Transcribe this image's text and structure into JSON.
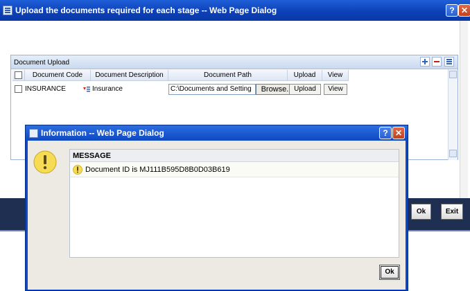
{
  "window": {
    "title": "Upload the documents required for each stage -- Web Page Dialog",
    "help_label": "?",
    "close_label": "✕"
  },
  "panel": {
    "title": "Document Upload",
    "columns": [
      "Document Code",
      "Document Description",
      "Document Path",
      "Upload",
      "View"
    ],
    "rows": [
      {
        "code": "INSURANCE",
        "description": "Insurance",
        "path": "C:\\Documents and Setting",
        "browse_label": "Browse...",
        "upload_label": "Upload",
        "view_label": "View"
      }
    ]
  },
  "footer": {
    "ok_label": "Ok",
    "exit_label": "Exit"
  },
  "dialog": {
    "title": "Information -- Web Page Dialog",
    "help_label": "?",
    "close_label": "✕",
    "message_header": "MESSAGE",
    "message": "Document ID is MJ111B595D8B0D03B619",
    "ok_label": "Ok"
  },
  "colors": {
    "titlebar": "#0c3fb6",
    "footer": "#1e2f52",
    "panel_header": "#cad9f0",
    "warning": "#f5d23a"
  },
  "icons": [
    "help-icon",
    "close-icon",
    "add-row-icon",
    "delete-row-icon",
    "grid-view-icon",
    "lookup-icon",
    "warning-icon"
  ]
}
